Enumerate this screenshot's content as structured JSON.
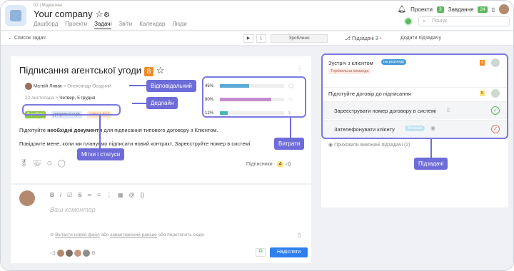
{
  "header": {
    "breadcrumb": "02 | Маркетинг",
    "company": "Your company",
    "nav": [
      "Дашборд",
      "Проекти",
      "Задачі",
      "Звіти",
      "Календар",
      "Люди"
    ],
    "projects_label": "Проекти",
    "projects_count": "3",
    "tasks_label": "Завдання",
    "tasks_count": "24",
    "search_placeholder": "Пошук"
  },
  "subbar": {
    "back": "Список задач",
    "done": "Зроблено",
    "subtasks_label": "Підзадачі",
    "subtasks_count": "3",
    "add_subtask": "Додати підзадачу"
  },
  "task": {
    "title": "Підписання агентської угоди",
    "number": "8",
    "assignee": "Матвій Ливак",
    "arrow": "<",
    "author": "Олександр Осадчий",
    "date_from": "22 листопада",
    "date_sep": ">",
    "date_to": "Четвер, 5 грудня",
    "tags": [
      "В роботі",
      "документація",
      "клієнт №1"
    ],
    "desc1_a": "Підготуйте ",
    "desc1_b": "необхідні документи",
    "desc1_c": " для підписання типового договору з Клієнтом.",
    "desc2": "Повідомте мене, коли ми плануємо підписати новий контракт. Зареєструйте номер в системі.",
    "subscribers": "Підписники",
    "subscribers_count": "4"
  },
  "costs": [
    {
      "pct": "45%",
      "fill": 0.45,
      "color": "#5aa9d6"
    },
    {
      "pct": "80%",
      "fill": 0.8,
      "color": "#c48bd0"
    },
    {
      "pct": "12%",
      "fill": 0.12,
      "color": "#4bb5b0"
    }
  ],
  "callouts": {
    "assignee": "Відповідальний",
    "deadline": "Дедлайн",
    "tags": "Мітки і статуси",
    "costs": "Витрати",
    "subtasks": "Підзадачі"
  },
  "comment": {
    "placeholder": "Ваш коментар",
    "attach_a": "Вкласти новий файл",
    "or1": "або",
    "attach_b": "завантажений раніше",
    "or2": "або",
    "attach_c": "перетягніть сюди",
    "send": "Надіслати"
  },
  "subtasks": {
    "items": [
      {
        "title": "Зустріч з клієнтом",
        "status": "на розгляді",
        "team": "Торгівельна команда",
        "num": "8"
      },
      {
        "title": "Підготуйте договір до підписання",
        "num": "5"
      },
      {
        "title": "Зареєструвати номер договору в системі"
      },
      {
        "title": "Зателефонувати клієнту",
        "tag": "Фінанси"
      }
    ],
    "hidden": "Приховати виконані підзадачі",
    "hidden_count": "(2)"
  }
}
